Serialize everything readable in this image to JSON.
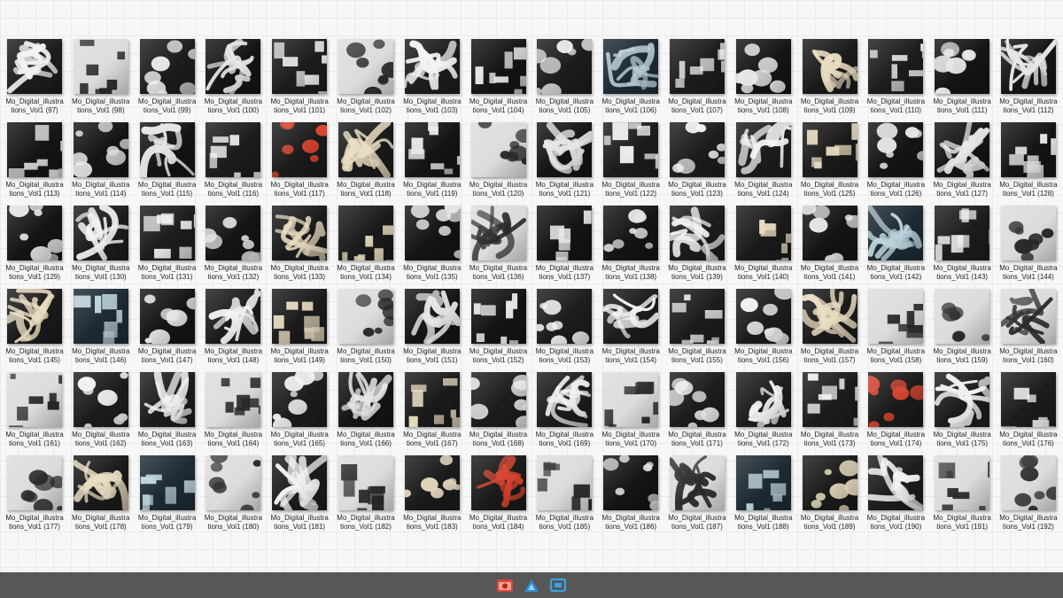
{
  "files": [
    {
      "name": "Mo_Digital_illustrations_Vol1 (97)",
      "tone": "bw"
    },
    {
      "name": "Mo_Digital_illustrations_Vol1 (98)",
      "tone": "light"
    },
    {
      "name": "Mo_Digital_illustrations_Vol1 (99)",
      "tone": "bw"
    },
    {
      "name": "Mo_Digital_illustrations_Vol1 (100)",
      "tone": "dark"
    },
    {
      "name": "Mo_Digital_illustrations_Vol1 (101)",
      "tone": "bw"
    },
    {
      "name": "Mo_Digital_illustrations_Vol1 (102)",
      "tone": "light"
    },
    {
      "name": "Mo_Digital_illustrations_Vol1 (103)",
      "tone": "bw"
    },
    {
      "name": "Mo_Digital_illustrations_Vol1 (104)",
      "tone": "dark"
    },
    {
      "name": "Mo_Digital_illustrations_Vol1 (105)",
      "tone": "bw"
    },
    {
      "name": "Mo_Digital_illustrations_Vol1 (106)",
      "tone": "blue"
    },
    {
      "name": "Mo_Digital_illustrations_Vol1 (107)",
      "tone": "bw"
    },
    {
      "name": "Mo_Digital_illustrations_Vol1 (108)",
      "tone": "dark"
    },
    {
      "name": "Mo_Digital_illustrations_Vol1 (109)",
      "tone": "gold"
    },
    {
      "name": "Mo_Digital_illustrations_Vol1 (110)",
      "tone": "bw"
    },
    {
      "name": "Mo_Digital_illustrations_Vol1 (111)",
      "tone": "dark"
    },
    {
      "name": "Mo_Digital_illustrations_Vol1 (112)",
      "tone": "dark"
    },
    {
      "name": "Mo_Digital_illustrations_Vol1 (113)",
      "tone": "dark"
    },
    {
      "name": "Mo_Digital_illustrations_Vol1 (114)",
      "tone": "dark"
    },
    {
      "name": "Mo_Digital_illustrations_Vol1 (115)",
      "tone": "dark"
    },
    {
      "name": "Mo_Digital_illustrations_Vol1 (116)",
      "tone": "bw"
    },
    {
      "name": "Mo_Digital_illustrations_Vol1 (117)",
      "tone": "red"
    },
    {
      "name": "Mo_Digital_illustrations_Vol1 (118)",
      "tone": "gold"
    },
    {
      "name": "Mo_Digital_illustrations_Vol1 (119)",
      "tone": "dark"
    },
    {
      "name": "Mo_Digital_illustrations_Vol1 (120)",
      "tone": "light"
    },
    {
      "name": "Mo_Digital_illustrations_Vol1 (121)",
      "tone": "dark"
    },
    {
      "name": "Mo_Digital_illustrations_Vol1 (122)",
      "tone": "bw"
    },
    {
      "name": "Mo_Digital_illustrations_Vol1 (123)",
      "tone": "bw"
    },
    {
      "name": "Mo_Digital_illustrations_Vol1 (124)",
      "tone": "bw"
    },
    {
      "name": "Mo_Digital_illustrations_Vol1 (125)",
      "tone": "gold"
    },
    {
      "name": "Mo_Digital_illustrations_Vol1 (126)",
      "tone": "dark"
    },
    {
      "name": "Mo_Digital_illustrations_Vol1 (127)",
      "tone": "dark"
    },
    {
      "name": "Mo_Digital_illustrations_Vol1 (128)",
      "tone": "dark"
    },
    {
      "name": "Mo_Digital_illustrations_Vol1 (129)",
      "tone": "dark"
    },
    {
      "name": "Mo_Digital_illustrations_Vol1 (130)",
      "tone": "bw"
    },
    {
      "name": "Mo_Digital_illustrations_Vol1 (131)",
      "tone": "bw"
    },
    {
      "name": "Mo_Digital_illustrations_Vol1 (132)",
      "tone": "dark"
    },
    {
      "name": "Mo_Digital_illustrations_Vol1 (133)",
      "tone": "gold"
    },
    {
      "name": "Mo_Digital_illustrations_Vol1 (134)",
      "tone": "gold"
    },
    {
      "name": "Mo_Digital_illustrations_Vol1 (135)",
      "tone": "dark"
    },
    {
      "name": "Mo_Digital_illustrations_Vol1 (136)",
      "tone": "light"
    },
    {
      "name": "Mo_Digital_illustrations_Vol1 (137)",
      "tone": "dark"
    },
    {
      "name": "Mo_Digital_illustrations_Vol1 (138)",
      "tone": "dark"
    },
    {
      "name": "Mo_Digital_illustrations_Vol1 (139)",
      "tone": "bw"
    },
    {
      "name": "Mo_Digital_illustrations_Vol1 (140)",
      "tone": "gold"
    },
    {
      "name": "Mo_Digital_illustrations_Vol1 (141)",
      "tone": "dark"
    },
    {
      "name": "Mo_Digital_illustrations_Vol1 (142)",
      "tone": "blue"
    },
    {
      "name": "Mo_Digital_illustrations_Vol1 (143)",
      "tone": "bw"
    },
    {
      "name": "Mo_Digital_illustrations_Vol1 (144)",
      "tone": "light"
    },
    {
      "name": "Mo_Digital_illustrations_Vol1 (145)",
      "tone": "gold"
    },
    {
      "name": "Mo_Digital_illustrations_Vol1 (146)",
      "tone": "blue"
    },
    {
      "name": "Mo_Digital_illustrations_Vol1 (147)",
      "tone": "dark"
    },
    {
      "name": "Mo_Digital_illustrations_Vol1 (148)",
      "tone": "bw"
    },
    {
      "name": "Mo_Digital_illustrations_Vol1 (149)",
      "tone": "gold"
    },
    {
      "name": "Mo_Digital_illustrations_Vol1 (150)",
      "tone": "light"
    },
    {
      "name": "Mo_Digital_illustrations_Vol1 (151)",
      "tone": "dark"
    },
    {
      "name": "Mo_Digital_illustrations_Vol1 (152)",
      "tone": "dark"
    },
    {
      "name": "Mo_Digital_illustrations_Vol1 (153)",
      "tone": "bw"
    },
    {
      "name": "Mo_Digital_illustrations_Vol1 (154)",
      "tone": "bw"
    },
    {
      "name": "Mo_Digital_illustrations_Vol1 (155)",
      "tone": "bw"
    },
    {
      "name": "Mo_Digital_illustrations_Vol1 (156)",
      "tone": "bw"
    },
    {
      "name": "Mo_Digital_illustrations_Vol1 (157)",
      "tone": "gold"
    },
    {
      "name": "Mo_Digital_illustrations_Vol1 (158)",
      "tone": "light"
    },
    {
      "name": "Mo_Digital_illustrations_Vol1 (159)",
      "tone": "light"
    },
    {
      "name": "Mo_Digital_illustrations_Vol1 (160)",
      "tone": "light"
    },
    {
      "name": "Mo_Digital_illustrations_Vol1 (161)",
      "tone": "light"
    },
    {
      "name": "Mo_Digital_illustrations_Vol1 (162)",
      "tone": "bw"
    },
    {
      "name": "Mo_Digital_illustrations_Vol1 (163)",
      "tone": "bw"
    },
    {
      "name": "Mo_Digital_illustrations_Vol1 (164)",
      "tone": "light"
    },
    {
      "name": "Mo_Digital_illustrations_Vol1 (165)",
      "tone": "bw"
    },
    {
      "name": "Mo_Digital_illustrations_Vol1 (166)",
      "tone": "dark"
    },
    {
      "name": "Mo_Digital_illustrations_Vol1 (167)",
      "tone": "gold"
    },
    {
      "name": "Mo_Digital_illustrations_Vol1 (168)",
      "tone": "bw"
    },
    {
      "name": "Mo_Digital_illustrations_Vol1 (169)",
      "tone": "bw"
    },
    {
      "name": "Mo_Digital_illustrations_Vol1 (170)",
      "tone": "light"
    },
    {
      "name": "Mo_Digital_illustrations_Vol1 (171)",
      "tone": "bw"
    },
    {
      "name": "Mo_Digital_illustrations_Vol1 (172)",
      "tone": "bw"
    },
    {
      "name": "Mo_Digital_illustrations_Vol1 (173)",
      "tone": "bw"
    },
    {
      "name": "Mo_Digital_illustrations_Vol1 (174)",
      "tone": "red"
    },
    {
      "name": "Mo_Digital_illustrations_Vol1 (175)",
      "tone": "bw"
    },
    {
      "name": "Mo_Digital_illustrations_Vol1 (176)",
      "tone": "bw"
    },
    {
      "name": "Mo_Digital_illustrations_Vol1 (177)",
      "tone": "light"
    },
    {
      "name": "Mo_Digital_illustrations_Vol1 (178)",
      "tone": "gold"
    },
    {
      "name": "Mo_Digital_illustrations_Vol1 (179)",
      "tone": "blue"
    },
    {
      "name": "Mo_Digital_illustrations_Vol1 (180)",
      "tone": "light"
    },
    {
      "name": "Mo_Digital_illustrations_Vol1 (181)",
      "tone": "bw"
    },
    {
      "name": "Mo_Digital_illustrations_Vol1 (182)",
      "tone": "light"
    },
    {
      "name": "Mo_Digital_illustrations_Vol1 (183)",
      "tone": "gold"
    },
    {
      "name": "Mo_Digital_illustrations_Vol1 (184)",
      "tone": "red"
    },
    {
      "name": "Mo_Digital_illustrations_Vol1 (185)",
      "tone": "light"
    },
    {
      "name": "Mo_Digital_illustrations_Vol1 (186)",
      "tone": "dark"
    },
    {
      "name": "Mo_Digital_illustrations_Vol1 (187)",
      "tone": "light"
    },
    {
      "name": "Mo_Digital_illustrations_Vol1 (188)",
      "tone": "blue"
    },
    {
      "name": "Mo_Digital_illustrations_Vol1 (189)",
      "tone": "gold"
    },
    {
      "name": "Mo_Digital_illustrations_Vol1 (190)",
      "tone": "bw"
    },
    {
      "name": "Mo_Digital_illustrations_Vol1 (191)",
      "tone": "light"
    },
    {
      "name": "Mo_Digital_illustrations_Vol1 (192)",
      "tone": "light"
    }
  ],
  "tone_colors": {
    "dark": {
      "base": "#141414",
      "ink": "#e6e6e6"
    },
    "bw": {
      "base": "#1c1c1c",
      "ink": "#f2f2f2"
    },
    "light": {
      "base": "#dcdcdc",
      "ink": "#2a2a2a"
    },
    "gold": {
      "base": "#1a1a1a",
      "ink": "#e9dcc0"
    },
    "blue": {
      "base": "#1d2a33",
      "ink": "#bcd2dc"
    },
    "red": {
      "base": "#1a1a1a",
      "ink": "#d8442e"
    }
  },
  "taskbar": {
    "icons": [
      {
        "name": "recorder-app-icon",
        "color": "#d9473b"
      },
      {
        "name": "vector-app-icon",
        "color": "#2a8fd6"
      },
      {
        "name": "screen-capture-app-icon",
        "color": "#3aa3e0"
      }
    ],
    "background": "#575757"
  }
}
